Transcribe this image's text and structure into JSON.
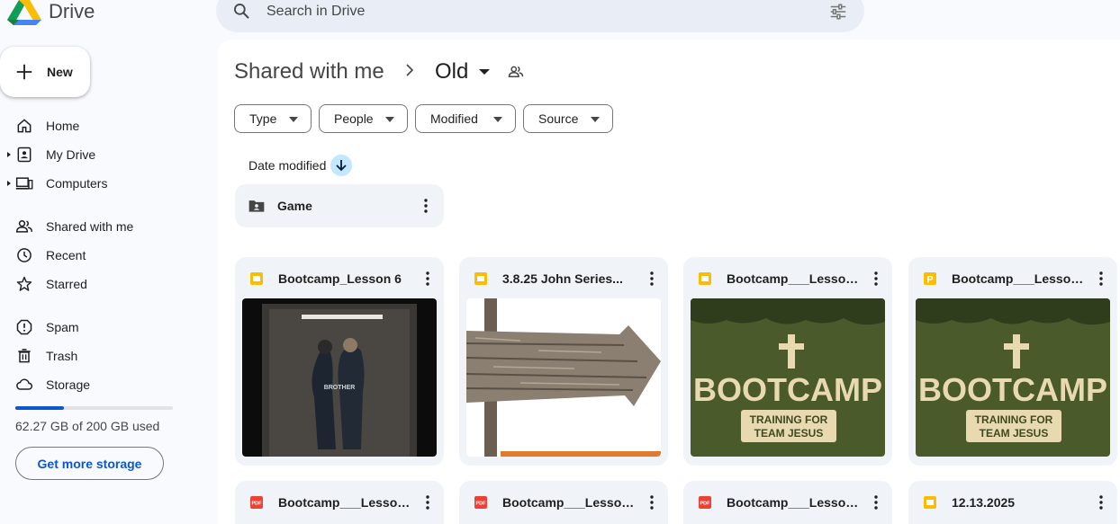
{
  "app": {
    "name": "Drive"
  },
  "search": {
    "placeholder": "Search in Drive"
  },
  "sidebar": {
    "new_label": "New",
    "items": [
      {
        "label": "Home",
        "icon": "home-icon"
      },
      {
        "label": "My Drive",
        "icon": "my-drive-icon"
      },
      {
        "label": "Computers",
        "icon": "computers-icon"
      },
      {
        "label": "Shared with me",
        "icon": "people-icon"
      },
      {
        "label": "Recent",
        "icon": "clock-icon"
      },
      {
        "label": "Starred",
        "icon": "star-icon"
      },
      {
        "label": "Spam",
        "icon": "spam-icon"
      },
      {
        "label": "Trash",
        "icon": "trash-icon"
      },
      {
        "label": "Storage",
        "icon": "cloud-icon"
      }
    ],
    "storage": {
      "used_text": "62.27 GB of 200 GB used",
      "used_fraction": 0.31,
      "button_label": "Get more storage"
    }
  },
  "breadcrumb": {
    "root": "Shared with me",
    "current": "Old"
  },
  "filters": [
    "Type",
    "People",
    "Modified",
    "Source"
  ],
  "sort": {
    "label": "Date modified"
  },
  "folders": [
    {
      "name": "Game"
    }
  ],
  "files": [
    {
      "name": "Bootcamp_Lesson 6",
      "type": "slides"
    },
    {
      "name": "3.8.25 John Series...",
      "type": "slides"
    },
    {
      "name": "Bootcamp___Lesson...",
      "type": "slides"
    },
    {
      "name": "Bootcamp___Lesson...",
      "type": "pptx"
    },
    {
      "name": "Bootcamp___Lesson...",
      "type": "pdf"
    },
    {
      "name": "Bootcamp___Lesson...",
      "type": "pdf"
    },
    {
      "name": "Bootcamp___Lesson...",
      "type": "pdf"
    },
    {
      "name": "12.13.2025",
      "type": "slides"
    }
  ],
  "thumbnails": {
    "elevator_text": "BROTHER",
    "bootcamp_title": "BOOTCAMP",
    "bootcamp_sub1": "TRAINING FOR",
    "bootcamp_sub2": "TEAM JESUS"
  },
  "colors": {
    "accent": "#0b57d0",
    "slides": "#fbbc04",
    "pdf": "#ea4335",
    "camo_green": "#4a5a2b"
  }
}
